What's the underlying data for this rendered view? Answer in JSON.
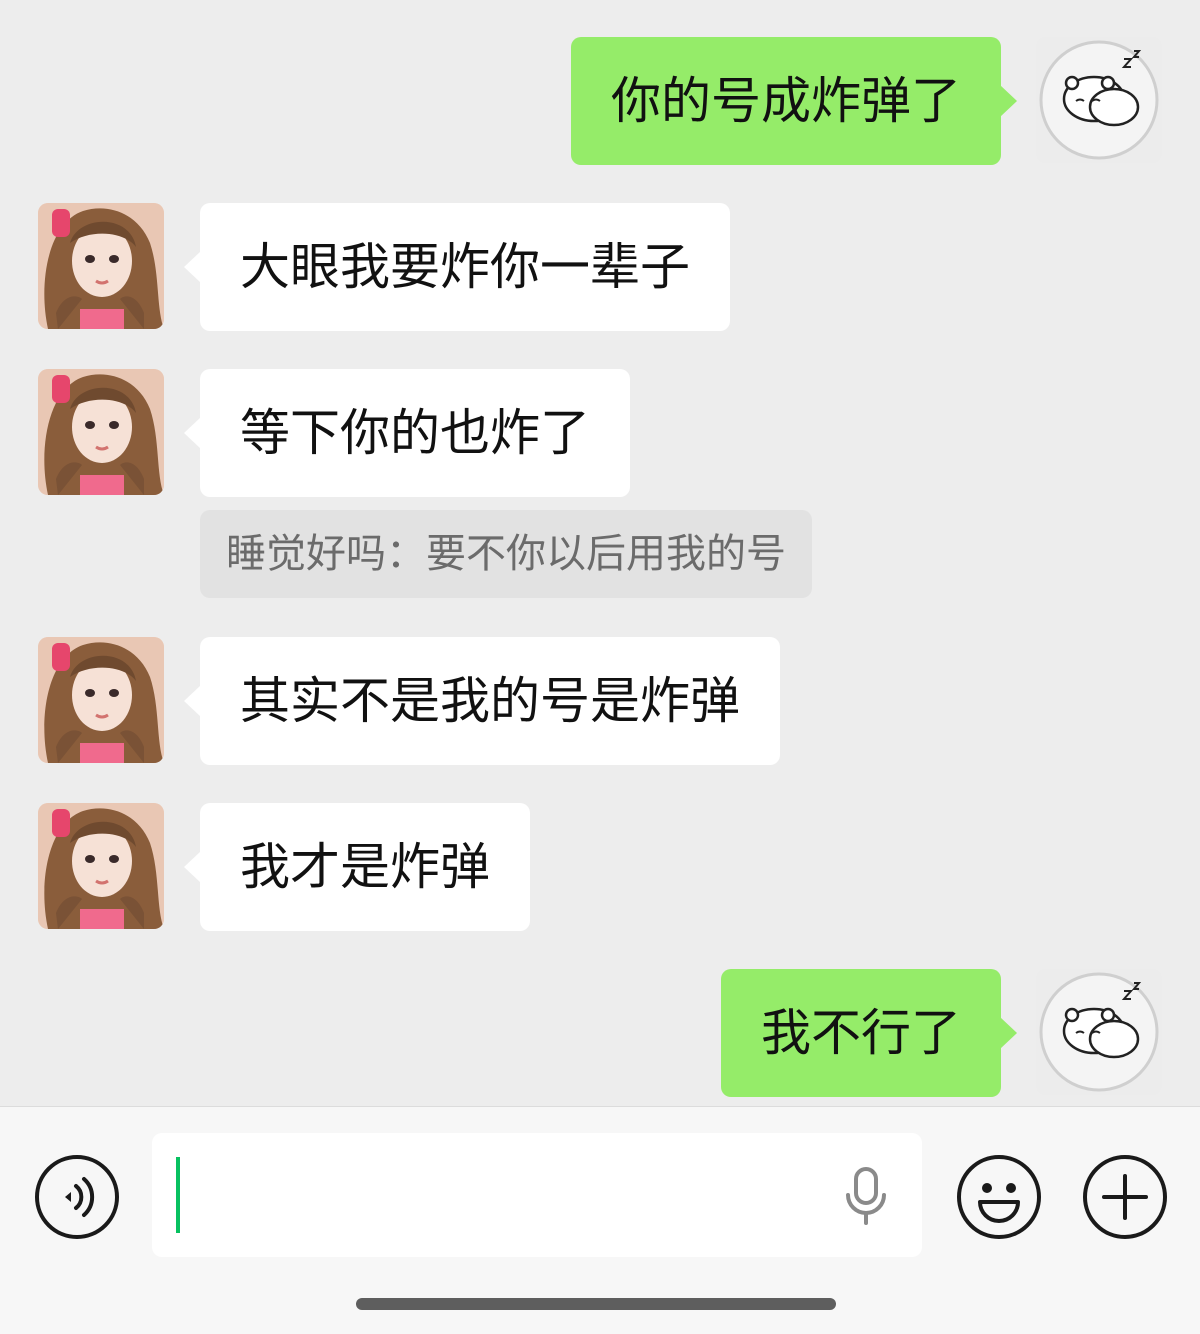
{
  "messages": [
    {
      "side": "out",
      "text": "你的号成炸弹了"
    },
    {
      "side": "in",
      "text": "大眼我要炸你一辈子"
    },
    {
      "side": "in",
      "text": "等下你的也炸了"
    },
    {
      "side": "quote",
      "text": "睡觉好吗：要不你以后用我的号"
    },
    {
      "side": "in",
      "text": "其实不是我的号是炸弹"
    },
    {
      "side": "in",
      "text": "我才是炸弹"
    },
    {
      "side": "out",
      "text": "我不行了"
    }
  ],
  "input": {
    "value": ""
  },
  "icons": {
    "voice": "voice-toggle-icon",
    "mic": "microphone-icon",
    "emoji": "emoji-icon",
    "more": "plus-icon"
  },
  "colors": {
    "background": "#ededed",
    "outgoing_bubble": "#95ec69",
    "incoming_bubble": "#ffffff",
    "quote_bg": "#e2e2e2",
    "caret": "#07c160"
  }
}
